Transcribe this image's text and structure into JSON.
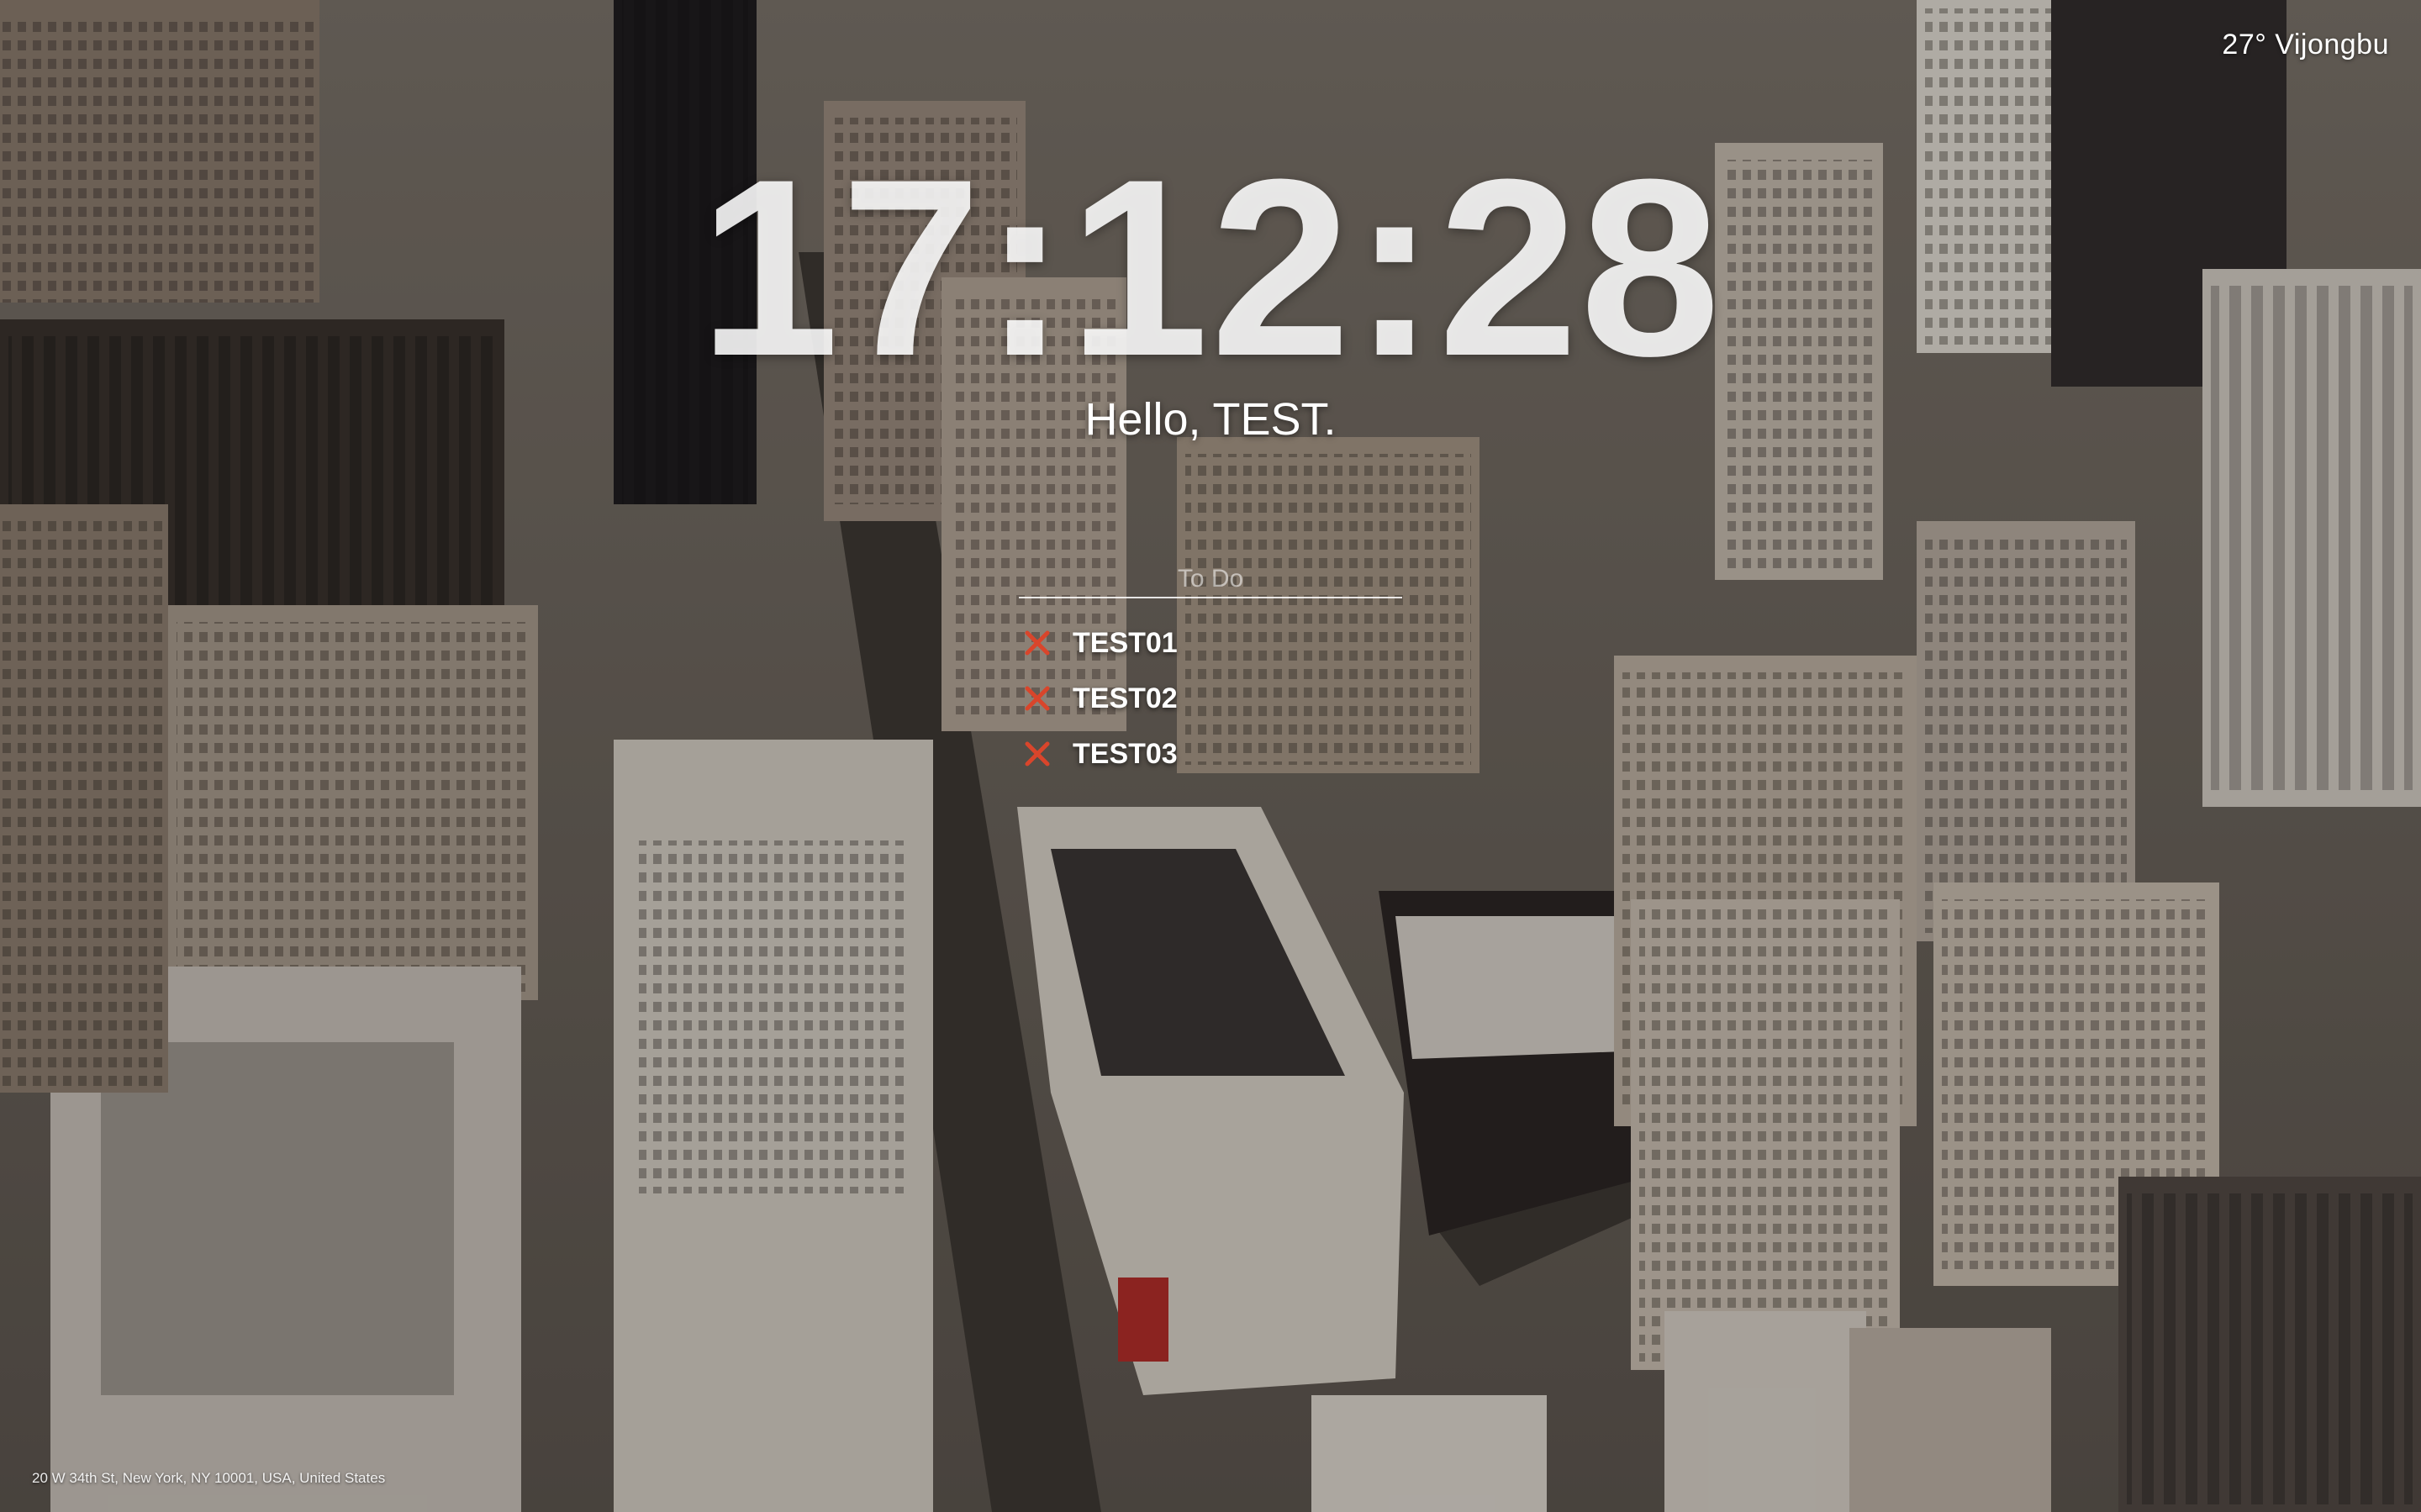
{
  "weather": {
    "text": "27° Vijongbu"
  },
  "clock": {
    "time": "17:12:28"
  },
  "greeting": {
    "text": "Hello, TEST."
  },
  "todo": {
    "placeholder": "To Do",
    "value": "",
    "delete_icon": "x-icon",
    "items": [
      {
        "label": "TEST01"
      },
      {
        "label": "TEST02"
      },
      {
        "label": "TEST03"
      }
    ]
  },
  "background": {
    "location": "20 W 34th St, New York, NY 10001, USA, United States"
  },
  "colors": {
    "text": "#ffffff",
    "delete_icon": "#d9452b"
  }
}
